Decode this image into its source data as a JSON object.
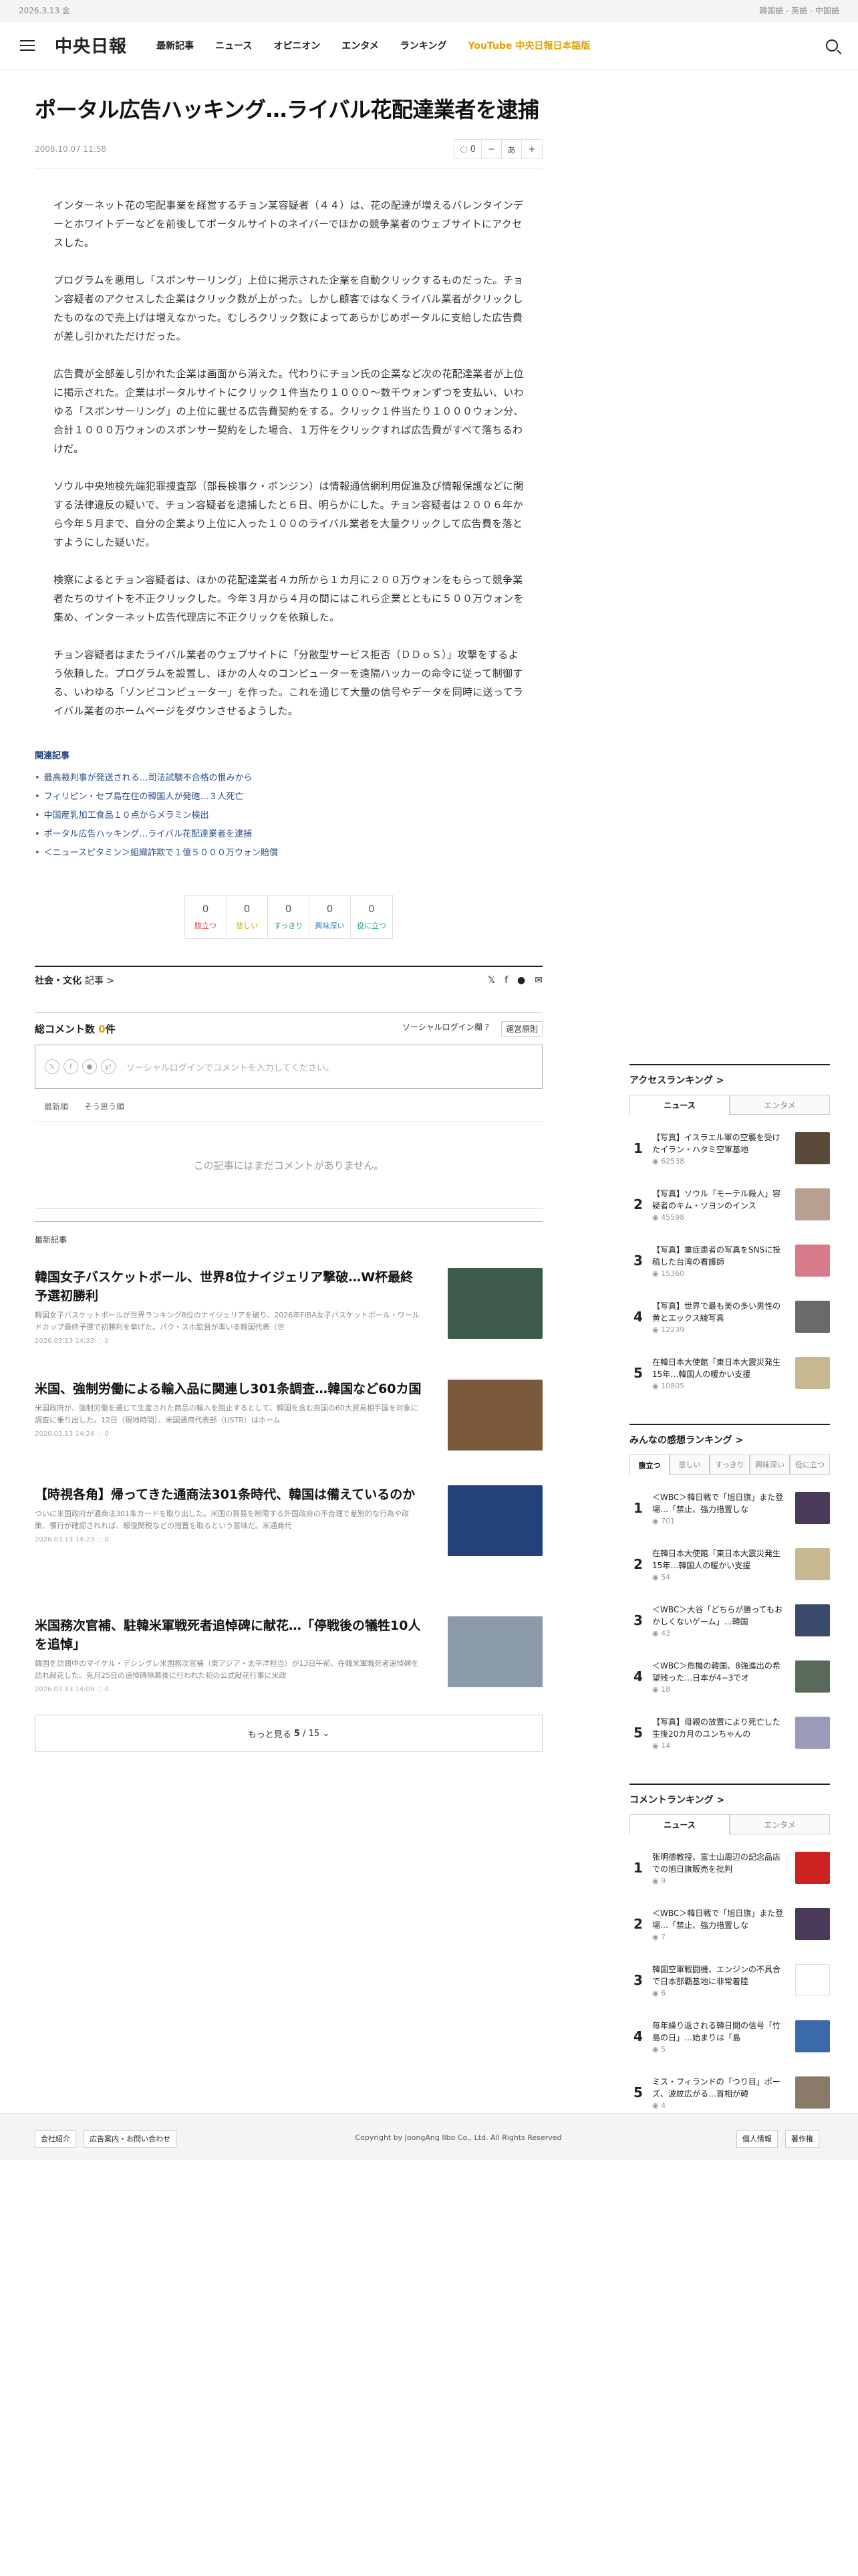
{
  "topbar": {
    "date": "2026.3.13 金",
    "langs": "韓国語 - 英語 - 中国語"
  },
  "nav": {
    "logo": "中央日報",
    "menu": [
      "最新記事",
      "ニュース",
      "オピニオン",
      "エンタメ",
      "ランキング"
    ],
    "youtube": "YouTube 中央日報日本語版"
  },
  "article": {
    "title": "ポータル広告ハッキング…ライバル花配達業者を逮捕",
    "date": "2008.10.07 11:58",
    "comment_count": "0",
    "font_tool": "あ",
    "paragraphs": [
      "インターネット花の宅配事業を経営するチョン某容疑者（４４）は、花の配達が増えるバレンタインデーとホワイトデーなどを前後してポータルサイトのネイバーでほかの競争業者のウェブサイトにアクセスした。",
      "プログラムを悪用し「スポンサーリング」上位に掲示された企業を自動クリックするものだった。チョン容疑者のアクセスした企業はクリック数が上がった。しかし顧客ではなくライバル業者がクリックしたものなので売上げは増えなかった。むしろクリック数によってあらかじめポータルに支給した広告費が差し引かれただけだった。",
      "広告費が全部差し引かれた企業は画面から消えた。代わりにチョン氏の企業など次の花配達業者が上位に掲示された。企業はポータルサイトにクリック１件当たり１０００～数千ウォンずつを支払い、いわゆる「スポンサーリング」の上位に載せる広告費契約をする。クリック１件当たり１０００ウォン分、合計１０００万ウォンのスポンサー契約をした場合、１万件をクリックすれば広告費がすべて落ちるわけだ。",
      "ソウル中央地検先端犯罪捜査部（部長検事ク・ボンジン）は情報通信網利用促進及び情報保護などに関する法律違反の疑いで、チョン容疑者を逮捕したと６日、明らかにした。チョン容疑者は２００６年から今年５月まで、自分の企業より上位に入った１００のライバル業者を大量クリックして広告費を落とすようにした疑いだ。",
      "検察によるとチョン容疑者は、ほかの花配達業者４カ所から１カ月に２００万ウォンをもらって競争業者たちのサイトを不正クリックした。今年３月から４月の間にはこれら企業とともに５００万ウォンを集め、インターネット広告代理店に不正クリックを依頼した。",
      "チョン容疑者はまたライバル業者のウェブサイトに「分散型サービス拒否（ＤＤｏＳ）」攻撃をするよう依頼した。プログラムを設置し、ほかの人々のコンピューターを遠隔ハッカーの命令に従って制御する、いわゆる「ゾンビコンピューター」を作った。これを通じて大量の信号やデータを同時に送ってライバル業者のホームページをダウンさせるようした。"
    ]
  },
  "related": {
    "title": "関連記事",
    "items": [
      "最高裁判事が発送される…司法試験不合格の恨みから",
      "フィリピン・セブ島在住の韓国人が発砲…３人死亡",
      "中国産乳加工食品１０点からメラミン検出",
      "ポータル広告ハッキング…ライバル花配達業者を逮捕",
      "＜ニュースピタミン＞組織詐欺で１億５０００万ウォン賠償"
    ]
  },
  "reactions": [
    {
      "count": "0",
      "label": "腹立つ",
      "color": "#d9534f"
    },
    {
      "count": "0",
      "label": "悲しい",
      "color": "#c8a400"
    },
    {
      "count": "0",
      "label": "すっきり",
      "color": "#2ea56a"
    },
    {
      "count": "0",
      "label": "興味深い",
      "color": "#3a7fc1"
    },
    {
      "count": "0",
      "label": "役に立つ",
      "color": "#2a9d8f"
    }
  ],
  "section": {
    "category": "社会・文化",
    "suffix": "記事 >"
  },
  "comments": {
    "title": "総コメント数",
    "count": "0",
    "unit": "件",
    "social_login": "ソーシャルログイン欄 ?",
    "rule": "運営原則",
    "placeholder": "ソーシャルログインでコメントを入力してください。",
    "tabs": [
      "最新順",
      "そう思う順"
    ],
    "empty": "この記事にはまだコメントがありません。"
  },
  "latest": {
    "label": "最新記事",
    "items": [
      {
        "title": "韓国女子バスケットボール、世界8位ナイジェリア撃破…W杯最終予選初勝利",
        "summary": "韓国女子バスケットボールが世界ランキング8位のナイジェリアを破り、2026年FIBA女子バスケットボール・ワールドカップ最終予選で初勝利を挙げた。パク・スホ監督が率いる韓国代表（世",
        "date": "2026.03.13 14:33",
        "comments": "0",
        "thumb": "#3d5a4a"
      },
      {
        "title": "米国、強制労働による輸入品に関連し301条調査…韓国など60カ国",
        "summary": "米国政府が、強制労働を通じて生産された商品の輸入を阻止するとして、韓国を含む自国の60大貿易相手国を対象に調査に乗り出した。12日（現地時間）、米国通商代表部（USTR）はホーム",
        "date": "2026.03.13 14:24",
        "comments": "0",
        "thumb": "#7a5a3a"
      },
      {
        "title": "【時視各角】帰ってきた通商法301条時代、韓国は備えているのか",
        "summary": "ついに米国政府が通商法301条カードを取り出した。米国の貿易を制限する外国政府の不合理で差別的な行為や政策、慣行が確認されれば、報復関税などの措置を取るという意味だ。米通商代",
        "date": "2026.03.13 14:23",
        "comments": "0",
        "thumb": "#23427a"
      },
      {
        "title": "米国務次官補、駐韓米軍戦死者追悼碑に献花…「停戦後の犠牲10人を追悼」",
        "summary": "韓国を訪問中のマイケル・デシングレ米国務次官補（東アジア・太平洋担当）が13日午前、在韓米軍戦死者追悼碑を訪れ献花した。先月25日の追悼碑除幕後に行われた初の公式献花行事に米政",
        "date": "2026.03.13 14:09",
        "comments": "0",
        "thumb": "#8a9aa8"
      }
    ],
    "more_prefix": "もっと見る",
    "more_page": "5",
    "more_total": "/ 15"
  },
  "access_ranking": {
    "title": "アクセスランキング >",
    "tabs": [
      "ニュース",
      "エンタメ"
    ],
    "items": [
      {
        "num": "1",
        "title": "【写真】イスラエル軍の空襲を受けたイラン・ハタミ空軍基地",
        "views": "62538",
        "thumb": "#5a4a3a"
      },
      {
        "num": "2",
        "title": "【写真】ソウル「モーテル殺人」容疑者のキム・ソヨンのインス",
        "views": "45598",
        "thumb": "#b8a090"
      },
      {
        "num": "3",
        "title": "【写真】重症患者の写真をSNSに投稿した台湾の看護師",
        "views": "15360",
        "thumb": "#d87a8a"
      },
      {
        "num": "4",
        "title": "【写真】世界で最も美の多い男性の黄とエックス線写真",
        "views": "12239",
        "thumb": "#6a6a6a"
      },
      {
        "num": "5",
        "title": "在韓日本大使館「東日本大震災発生15年…韓国人の暖かい支援",
        "views": "10805",
        "thumb": "#c8b890"
      }
    ]
  },
  "emotion_ranking": {
    "title": "みんなの感想ランキング >",
    "tabs": [
      "腹立つ",
      "悲しい",
      "すっきり",
      "興味深い",
      "役に立つ"
    ],
    "items": [
      {
        "num": "1",
        "title": "＜WBC＞韓日戦で「旭日旗」また登場…「禁止、強力措置しな",
        "views": "701",
        "thumb": "#4a3a5a"
      },
      {
        "num": "2",
        "title": "在韓日本大使館「東日本大震災発生15年…韓国人の暖かい支援",
        "views": "54",
        "thumb": "#c8b890"
      },
      {
        "num": "3",
        "title": "＜WBC＞大谷「どちらが勝ってもおかしくないゲーム」…韓国",
        "views": "43",
        "thumb": "#3a4a6a"
      },
      {
        "num": "4",
        "title": "＜WBC＞危機の韓国、8強進出の希望残った…日本が4−3でオ",
        "views": "18",
        "thumb": "#5a6a5a"
      },
      {
        "num": "5",
        "title": "【写真】母親の放置により死亡した生後20カ月のユンちゃんの",
        "views": "14",
        "thumb": "#9a9aba"
      }
    ]
  },
  "comment_ranking": {
    "title": "コメントランキング >",
    "tabs": [
      "ニュース",
      "エンタメ"
    ],
    "items": [
      {
        "num": "1",
        "title": "张明德教授、富士山周辺の記念品店での旭日旗販売を批判",
        "views": "9",
        "thumb": "#cc2222"
      },
      {
        "num": "2",
        "title": "＜WBC＞韓日戦で「旭日旗」また登場…「禁止、強力措置しな",
        "views": "7",
        "thumb": "#4a3a5a"
      },
      {
        "num": "3",
        "title": "韓国空軍戦闘機、エンジンの不具合で日本那覇基地に非常着陸",
        "views": "6",
        "thumb": "#ffffff"
      },
      {
        "num": "4",
        "title": "毎年繰り返される韓日間の信号「竹島の日」…始まりは「島",
        "views": "5",
        "thumb": "#3a6aaa"
      },
      {
        "num": "5",
        "title": "ミス・フィランドの「つり目」ポーズ、波紋広がる…首相が韓",
        "views": "4",
        "thumb": "#8a7a6a"
      }
    ]
  },
  "footer": {
    "links": [
      "会社紹介",
      "広告案内・お問い合わせ"
    ],
    "copyright": "Copyright by JoongAng Ilbo Co., Ltd. All Rights Reserved",
    "right_links": [
      "個人情報",
      "著作権"
    ]
  }
}
